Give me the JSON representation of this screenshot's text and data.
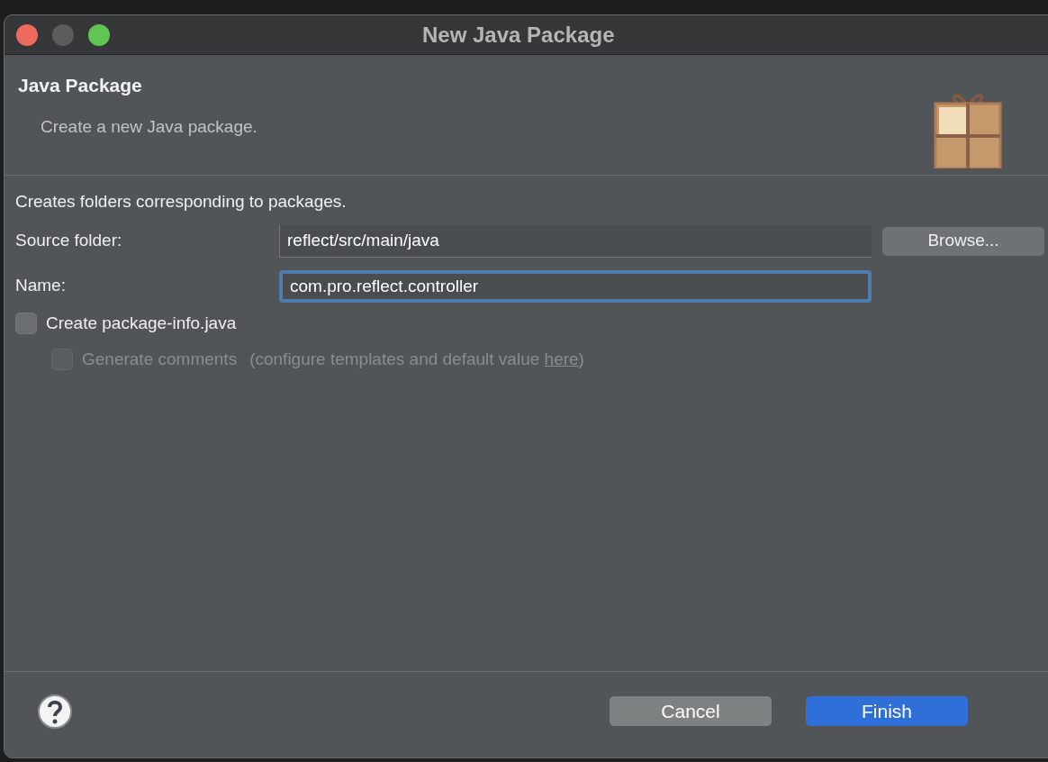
{
  "window": {
    "title": "New Java Package"
  },
  "header": {
    "title": "Java Package",
    "description": "Create a new Java package."
  },
  "intro": "Creates folders corresponding to packages.",
  "fields": [
    {
      "label": "Source folder:",
      "value": "reflect/src/main/java",
      "focused": false,
      "button": "Browse..."
    },
    {
      "label": "Name:",
      "value": "com.pro.reflect.controller",
      "focused": true
    }
  ],
  "options": [
    {
      "label": "Create package-info.java",
      "checked": false,
      "disabled": false
    },
    {
      "label": "Generate comments",
      "checked": false,
      "disabled": true,
      "hint_before": "(configure templates and default value ",
      "hint_link": "here",
      "hint_after": ")"
    }
  ],
  "buttons": [
    {
      "label": "Cancel",
      "default": false
    },
    {
      "label": "Finish",
      "default": true
    }
  ]
}
